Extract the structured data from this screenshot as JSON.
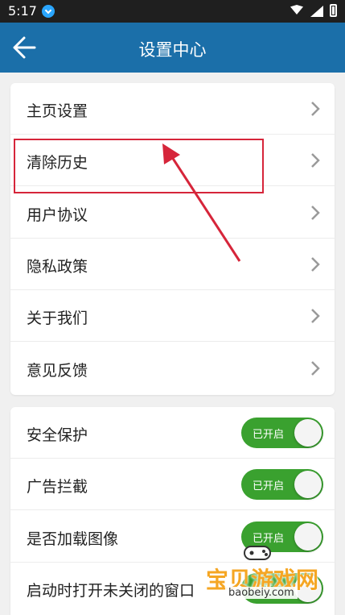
{
  "status_bar": {
    "time": "5:17"
  },
  "app_bar": {
    "title": "设置中心"
  },
  "menu_items": [
    {
      "label": "主页设置"
    },
    {
      "label": "清除历史"
    },
    {
      "label": "用户协议"
    },
    {
      "label": "隐私政策"
    },
    {
      "label": "关于我们"
    },
    {
      "label": "意见反馈"
    }
  ],
  "toggle_items": [
    {
      "label": "安全保护",
      "state": "已开启"
    },
    {
      "label": "广告拦截",
      "state": "已开启"
    },
    {
      "label": "是否加载图像",
      "state": "已开启"
    },
    {
      "label": "启动时打开未关闭的窗口",
      "state": "已开启"
    }
  ],
  "watermark": {
    "text": "宝贝游戏网",
    "url": "baobeiy.com"
  },
  "colors": {
    "app_bar": "#1b6fa9",
    "toggle_on": "#3aa12f",
    "highlight": "#d6253a"
  }
}
